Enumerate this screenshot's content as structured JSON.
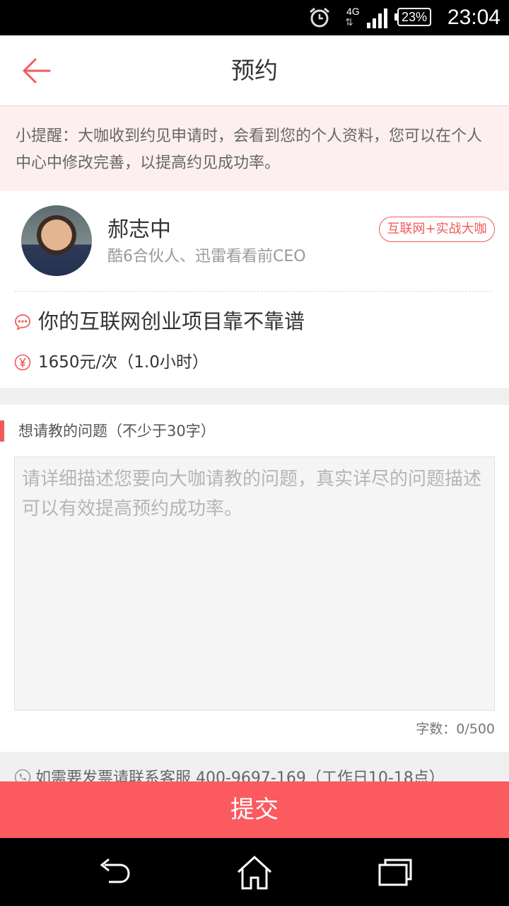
{
  "status_bar": {
    "network": "4G",
    "battery": "23%",
    "time": "23:04",
    "icons": [
      "alarm-icon",
      "data-arrows-icon",
      "signal-icon",
      "battery-icon"
    ]
  },
  "header": {
    "title": "预约",
    "back_icon": "arrow-left-icon"
  },
  "reminder": {
    "text": "小提醒：大咖收到约见申请时，会看到您的个人资料，您可以在个人中心中修改完善，以提高约见成功率。"
  },
  "expert": {
    "name": "郝志中",
    "role": "酷6合伙人、迅雷看看前CEO",
    "tag": "互联网+实战大咖",
    "topic": "你的互联网创业项目靠不靠谱",
    "price": "1650元/次（1.0小时）"
  },
  "question": {
    "label": "想请教的问题（不少于30字）",
    "placeholder": "请详细描述您要向大咖请教的问题，真实详尽的问题描述可以有效提高预约成功率。",
    "count": "字数：0/500"
  },
  "contact": {
    "text": "如需要发票请联系客服 400-9697-169（工作日10-18点）"
  },
  "submit": {
    "label": "提交"
  },
  "colors": {
    "accent": "#fb5a5f",
    "tag_red": "#f25a5a",
    "reminder_bg": "#fdefef"
  }
}
